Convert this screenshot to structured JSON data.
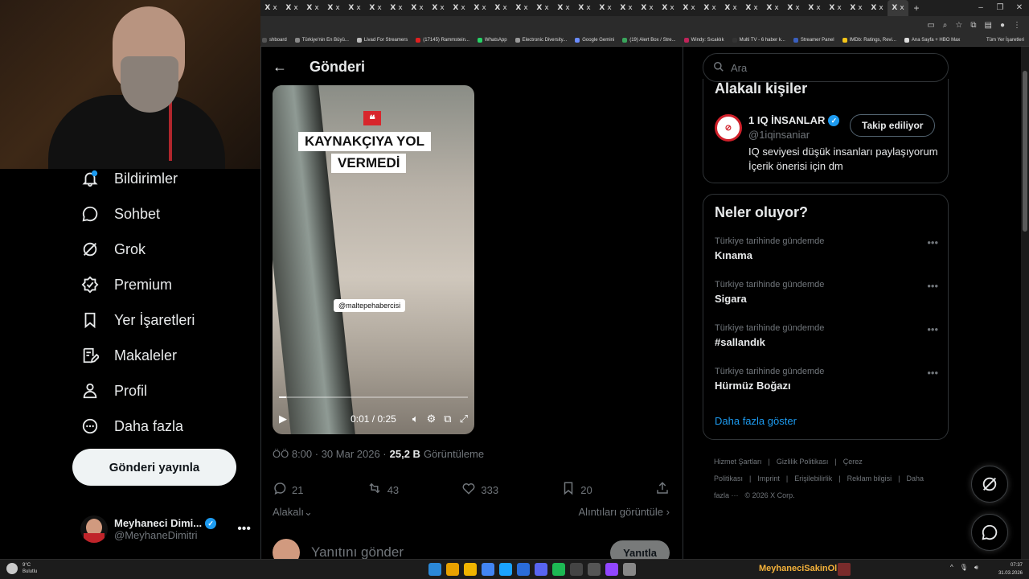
{
  "browser": {
    "tab_glyph": "X",
    "tab_close": "x",
    "new_tab": "+",
    "window_controls": [
      "–",
      "❐",
      "✕"
    ],
    "bookmarks": [
      {
        "label": "shboard",
        "color": "#555"
      },
      {
        "label": "Türkiye'nin En Büyü...",
        "color": "#888"
      },
      {
        "label": "Livad For Streamers",
        "color": "#bbb"
      },
      {
        "label": "(17145) Rammstein...",
        "color": "#e02020"
      },
      {
        "label": "WhatsApp",
        "color": "#25d366"
      },
      {
        "label": "Electronic Diversity...",
        "color": "#999"
      },
      {
        "label": "Google Gemini",
        "color": "#6a8cff"
      },
      {
        "label": "(19) Alert Box / Stre...",
        "color": "#3aa55c"
      },
      {
        "label": "Windy: Sıcaklık",
        "color": "#c0245a"
      },
      {
        "label": "Multi TV - 6 haber k...",
        "color": "#333"
      },
      {
        "label": "Streamer Panel",
        "color": "#3a5fbf"
      },
      {
        "label": "IMDb: Ratings, Revi...",
        "color": "#f5c518"
      },
      {
        "label": "Ana Sayfa + HBO Max",
        "color": "#ddd"
      }
    ],
    "bookmarks_right": "Tüm Yer İşaretleri"
  },
  "sidebar": {
    "items": [
      {
        "label": "Bildirimler",
        "icon": "bell-icon"
      },
      {
        "label": "Sohbet",
        "icon": "chat-icon"
      },
      {
        "label": "Grok",
        "icon": "grok-icon"
      },
      {
        "label": "Premium",
        "icon": "premium-icon"
      },
      {
        "label": "Yer İşaretleri",
        "icon": "bookmark-icon"
      },
      {
        "label": "Makaleler",
        "icon": "article-icon"
      },
      {
        "label": "Profil",
        "icon": "profile-icon"
      },
      {
        "label": "Daha fazla",
        "icon": "more-icon"
      }
    ],
    "post_button": "Gönderi yayınla",
    "account": {
      "name": "Meyhaneci Dimi...",
      "handle": "@MeyhaneDimitri",
      "more": "•••"
    }
  },
  "main": {
    "back": "←",
    "title": "Gönderi",
    "video": {
      "quote": "❝",
      "caption_line1": "KAYNAKÇIYA YOL",
      "caption_line2": "VERMEDİ",
      "watermark": "@maltepehabercisi",
      "time": "0:01 / 0:25",
      "progress": 0.04
    },
    "meta": {
      "time": "ÖÖ 8:00 · 30 Mar 2026 ·",
      "views": "25,2 B",
      "views_label": "Görüntüleme"
    },
    "actions": {
      "replies": "21",
      "reposts": "43",
      "likes": "333",
      "bookmarks": "20"
    },
    "sort_label": "Alakalı",
    "quotes_label": "Alıntıları görüntüle",
    "reply_placeholder": "Yanıtını gönder",
    "reply_button": "Yanıtla"
  },
  "right": {
    "search_placeholder": "Ara",
    "related_title": "Alakalı kişiler",
    "person": {
      "name": "1 IQ İNSANLAR",
      "handle": "@1iqinsaniar",
      "bio": "IQ seviyesi düşük insanları paylaşıyorum İçerik önerisi için dm",
      "follow": "Takip ediliyor"
    },
    "trends_title": "Neler oluyor?",
    "trends": [
      {
        "context": "Türkiye tarihinde gündemde",
        "topic": "Kınama"
      },
      {
        "context": "Türkiye tarihinde gündemde",
        "topic": "Sigara"
      },
      {
        "context": "Türkiye tarihinde gündemde",
        "topic": "#sallandık"
      },
      {
        "context": "Türkiye tarihinde gündemde",
        "topic": "Hürmüz Boğazı"
      }
    ],
    "trend_more": "•••",
    "show_more": "Daha fazla göster",
    "footer": [
      "Hizmet Şartları",
      "|",
      "Gizlilik Politikası",
      "|",
      "Çerez Politikası",
      "|",
      "Imprint",
      "|",
      "Erişilebilirlik",
      "|",
      "Reklam bilgisi",
      "|",
      "Daha fazla ···",
      "© 2026 X Corp."
    ]
  },
  "taskbar": {
    "weather_temp": "9°C",
    "weather_desc": "Bulutlu",
    "channel": "MeyhaneciSakinOl",
    "time": "07:37",
    "date": "31.03.2026",
    "app_colors": [
      "#2b88d8",
      "#e8a100",
      "#f0b400",
      "#4285f4",
      "#1aa3ff",
      "#2a6cd9",
      "#5865f2",
      "#1db954",
      "#444",
      "#555",
      "#9146ff",
      "#888"
    ]
  }
}
